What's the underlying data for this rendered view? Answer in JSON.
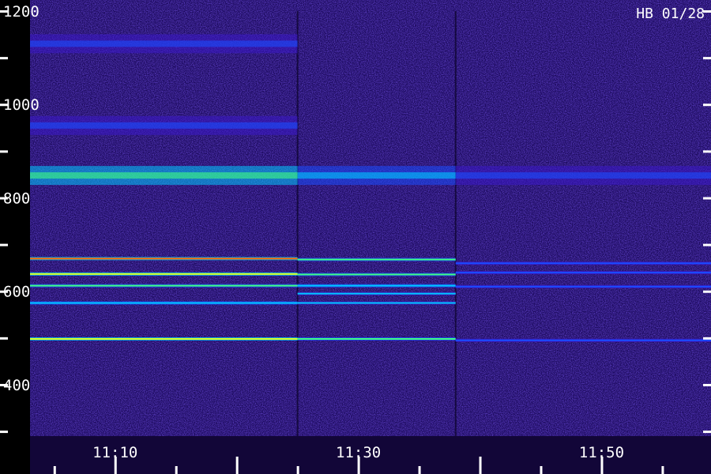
{
  "stamp": "HB 01/28",
  "chart_data": {
    "type": "heatmap",
    "title": "",
    "xlabel": "",
    "ylabel": "",
    "ylim": [
      290,
      1200
    ],
    "x_time_range": [
      "11:03",
      "11:59"
    ],
    "y_ticks": [
      400,
      600,
      800,
      1000,
      1200
    ],
    "y_tick_labels": [
      "400",
      "600",
      "800",
      "1000",
      "1200"
    ],
    "y_minor_ticks": [
      300,
      500,
      700,
      900,
      1100
    ],
    "x_tick_labels": [
      "11:10",
      "11:30",
      "11:50"
    ],
    "x_major_ticks": [
      "11:10",
      "11:20",
      "11:30",
      "11:40",
      "11:50"
    ],
    "x_minor_ticks": [
      "11:05",
      "11:15",
      "11:25",
      "11:35",
      "11:45",
      "11:55"
    ],
    "segment_breaks": [
      "11:25",
      "11:38"
    ],
    "colormap": [
      "#000000",
      "#2a0a7a",
      "#3a18c8",
      "#1a4cff",
      "#00c8ff",
      "#40ff80",
      "#e0ff20",
      "#ff6a00"
    ],
    "lines": [
      {
        "freq": 670,
        "from": "11:03",
        "to": "11:25",
        "level": 0.95
      },
      {
        "freq": 637,
        "from": "11:03",
        "to": "11:25",
        "level": 0.92
      },
      {
        "freq": 612,
        "from": "11:03",
        "to": "11:25",
        "level": 0.72
      },
      {
        "freq": 575,
        "from": "11:03",
        "to": "11:25",
        "level": 0.6
      },
      {
        "freq": 498,
        "from": "11:03",
        "to": "11:25",
        "level": 0.85
      },
      {
        "freq": 668,
        "from": "11:25",
        "to": "11:38",
        "level": 0.7
      },
      {
        "freq": 636,
        "from": "11:25",
        "to": "11:38",
        "level": 0.75
      },
      {
        "freq": 612,
        "from": "11:25",
        "to": "11:38",
        "level": 0.6
      },
      {
        "freq": 595,
        "from": "11:25",
        "to": "11:38",
        "level": 0.55
      },
      {
        "freq": 575,
        "from": "11:25",
        "to": "11:38",
        "level": 0.55
      },
      {
        "freq": 498,
        "from": "11:25",
        "to": "11:38",
        "level": 0.7
      },
      {
        "freq": 660,
        "from": "11:38",
        "to": "11:59",
        "level": 0.45
      },
      {
        "freq": 640,
        "from": "11:38",
        "to": "11:59",
        "level": 0.42
      },
      {
        "freq": 610,
        "from": "11:38",
        "to": "11:59",
        "level": 0.4
      },
      {
        "freq": 495,
        "from": "11:38",
        "to": "11:59",
        "level": 0.45
      }
    ],
    "bands": [
      {
        "freq": 848,
        "from": "11:03",
        "to": "11:25",
        "level": 0.55
      },
      {
        "freq": 955,
        "from": "11:03",
        "to": "11:25",
        "level": 0.32
      },
      {
        "freq": 1130,
        "from": "11:03",
        "to": "11:25",
        "level": 0.3
      },
      {
        "freq": 848,
        "from": "11:25",
        "to": "11:38",
        "level": 0.4
      },
      {
        "freq": 848,
        "from": "11:38",
        "to": "11:59",
        "level": 0.22
      }
    ]
  }
}
